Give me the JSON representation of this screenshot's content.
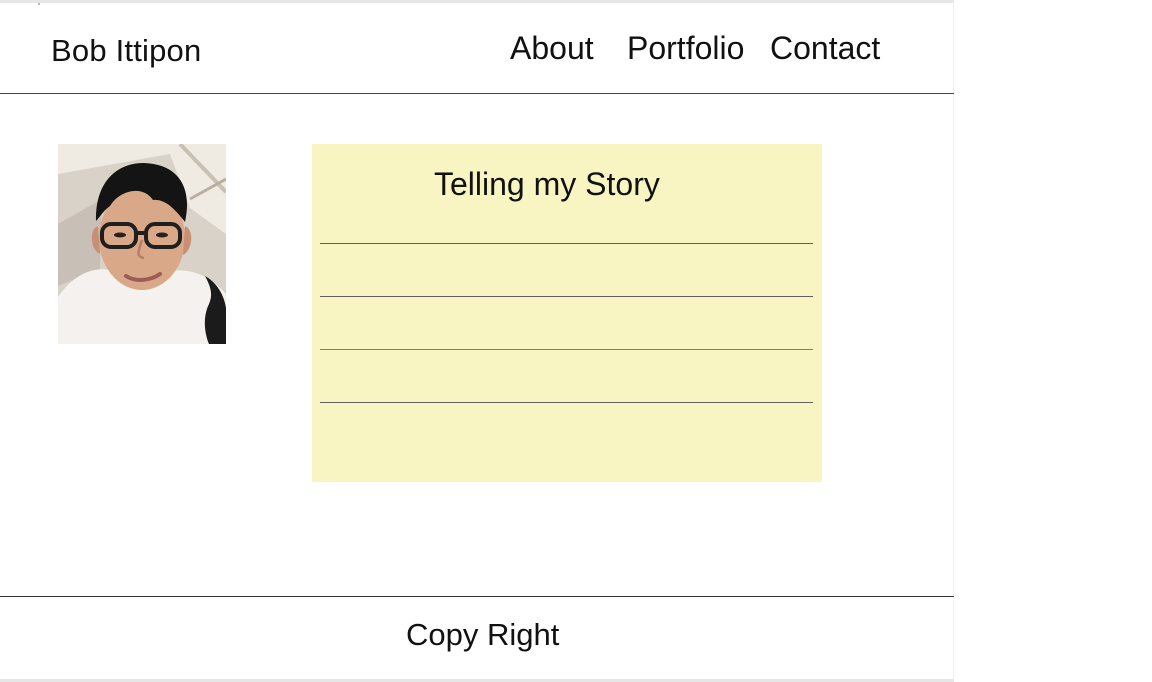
{
  "header": {
    "brand": "Bob Ittipon",
    "nav": [
      {
        "label": "About"
      },
      {
        "label": "Portfolio"
      },
      {
        "label": "Contact"
      }
    ]
  },
  "main": {
    "photo": {
      "icon": "profile-photo",
      "colors": {
        "background": "#d8d2c8",
        "skin": "#d9a889",
        "hair": "#141414",
        "shirt": "#f4f1ee"
      }
    },
    "story": {
      "title": "Telling my Story",
      "background": "#f8f5c2",
      "line_count": 4
    }
  },
  "footer": {
    "text": "Copy Right"
  }
}
